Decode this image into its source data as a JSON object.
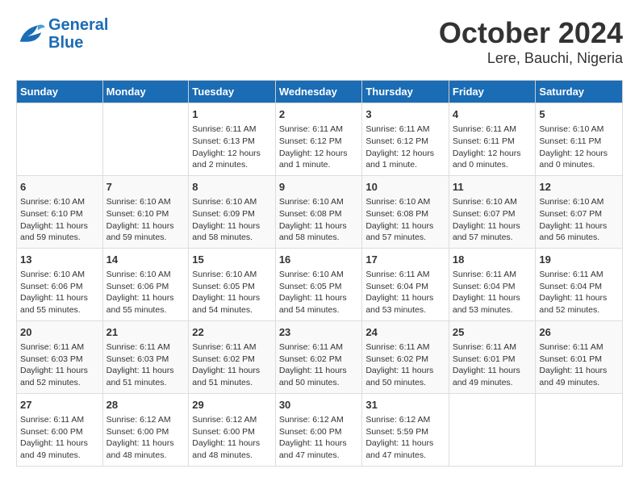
{
  "header": {
    "logo_line1": "General",
    "logo_line2": "Blue",
    "title": "October 2024",
    "subtitle": "Lere, Bauchi, Nigeria"
  },
  "weekdays": [
    "Sunday",
    "Monday",
    "Tuesday",
    "Wednesday",
    "Thursday",
    "Friday",
    "Saturday"
  ],
  "weeks": [
    [
      {
        "day": "",
        "empty": true
      },
      {
        "day": "",
        "empty": true
      },
      {
        "day": "1",
        "line1": "Sunrise: 6:11 AM",
        "line2": "Sunset: 6:13 PM",
        "line3": "Daylight: 12 hours",
        "line4": "and 2 minutes."
      },
      {
        "day": "2",
        "line1": "Sunrise: 6:11 AM",
        "line2": "Sunset: 6:12 PM",
        "line3": "Daylight: 12 hours",
        "line4": "and 1 minute."
      },
      {
        "day": "3",
        "line1": "Sunrise: 6:11 AM",
        "line2": "Sunset: 6:12 PM",
        "line3": "Daylight: 12 hours",
        "line4": "and 1 minute."
      },
      {
        "day": "4",
        "line1": "Sunrise: 6:11 AM",
        "line2": "Sunset: 6:11 PM",
        "line3": "Daylight: 12 hours",
        "line4": "and 0 minutes."
      },
      {
        "day": "5",
        "line1": "Sunrise: 6:10 AM",
        "line2": "Sunset: 6:11 PM",
        "line3": "Daylight: 12 hours",
        "line4": "and 0 minutes."
      }
    ],
    [
      {
        "day": "6",
        "line1": "Sunrise: 6:10 AM",
        "line2": "Sunset: 6:10 PM",
        "line3": "Daylight: 11 hours",
        "line4": "and 59 minutes."
      },
      {
        "day": "7",
        "line1": "Sunrise: 6:10 AM",
        "line2": "Sunset: 6:10 PM",
        "line3": "Daylight: 11 hours",
        "line4": "and 59 minutes."
      },
      {
        "day": "8",
        "line1": "Sunrise: 6:10 AM",
        "line2": "Sunset: 6:09 PM",
        "line3": "Daylight: 11 hours",
        "line4": "and 58 minutes."
      },
      {
        "day": "9",
        "line1": "Sunrise: 6:10 AM",
        "line2": "Sunset: 6:08 PM",
        "line3": "Daylight: 11 hours",
        "line4": "and 58 minutes."
      },
      {
        "day": "10",
        "line1": "Sunrise: 6:10 AM",
        "line2": "Sunset: 6:08 PM",
        "line3": "Daylight: 11 hours",
        "line4": "and 57 minutes."
      },
      {
        "day": "11",
        "line1": "Sunrise: 6:10 AM",
        "line2": "Sunset: 6:07 PM",
        "line3": "Daylight: 11 hours",
        "line4": "and 57 minutes."
      },
      {
        "day": "12",
        "line1": "Sunrise: 6:10 AM",
        "line2": "Sunset: 6:07 PM",
        "line3": "Daylight: 11 hours",
        "line4": "and 56 minutes."
      }
    ],
    [
      {
        "day": "13",
        "line1": "Sunrise: 6:10 AM",
        "line2": "Sunset: 6:06 PM",
        "line3": "Daylight: 11 hours",
        "line4": "and 55 minutes."
      },
      {
        "day": "14",
        "line1": "Sunrise: 6:10 AM",
        "line2": "Sunset: 6:06 PM",
        "line3": "Daylight: 11 hours",
        "line4": "and 55 minutes."
      },
      {
        "day": "15",
        "line1": "Sunrise: 6:10 AM",
        "line2": "Sunset: 6:05 PM",
        "line3": "Daylight: 11 hours",
        "line4": "and 54 minutes."
      },
      {
        "day": "16",
        "line1": "Sunrise: 6:10 AM",
        "line2": "Sunset: 6:05 PM",
        "line3": "Daylight: 11 hours",
        "line4": "and 54 minutes."
      },
      {
        "day": "17",
        "line1": "Sunrise: 6:11 AM",
        "line2": "Sunset: 6:04 PM",
        "line3": "Daylight: 11 hours",
        "line4": "and 53 minutes."
      },
      {
        "day": "18",
        "line1": "Sunrise: 6:11 AM",
        "line2": "Sunset: 6:04 PM",
        "line3": "Daylight: 11 hours",
        "line4": "and 53 minutes."
      },
      {
        "day": "19",
        "line1": "Sunrise: 6:11 AM",
        "line2": "Sunset: 6:04 PM",
        "line3": "Daylight: 11 hours",
        "line4": "and 52 minutes."
      }
    ],
    [
      {
        "day": "20",
        "line1": "Sunrise: 6:11 AM",
        "line2": "Sunset: 6:03 PM",
        "line3": "Daylight: 11 hours",
        "line4": "and 52 minutes."
      },
      {
        "day": "21",
        "line1": "Sunrise: 6:11 AM",
        "line2": "Sunset: 6:03 PM",
        "line3": "Daylight: 11 hours",
        "line4": "and 51 minutes."
      },
      {
        "day": "22",
        "line1": "Sunrise: 6:11 AM",
        "line2": "Sunset: 6:02 PM",
        "line3": "Daylight: 11 hours",
        "line4": "and 51 minutes."
      },
      {
        "day": "23",
        "line1": "Sunrise: 6:11 AM",
        "line2": "Sunset: 6:02 PM",
        "line3": "Daylight: 11 hours",
        "line4": "and 50 minutes."
      },
      {
        "day": "24",
        "line1": "Sunrise: 6:11 AM",
        "line2": "Sunset: 6:02 PM",
        "line3": "Daylight: 11 hours",
        "line4": "and 50 minutes."
      },
      {
        "day": "25",
        "line1": "Sunrise: 6:11 AM",
        "line2": "Sunset: 6:01 PM",
        "line3": "Daylight: 11 hours",
        "line4": "and 49 minutes."
      },
      {
        "day": "26",
        "line1": "Sunrise: 6:11 AM",
        "line2": "Sunset: 6:01 PM",
        "line3": "Daylight: 11 hours",
        "line4": "and 49 minutes."
      }
    ],
    [
      {
        "day": "27",
        "line1": "Sunrise: 6:11 AM",
        "line2": "Sunset: 6:00 PM",
        "line3": "Daylight: 11 hours",
        "line4": "and 49 minutes."
      },
      {
        "day": "28",
        "line1": "Sunrise: 6:12 AM",
        "line2": "Sunset: 6:00 PM",
        "line3": "Daylight: 11 hours",
        "line4": "and 48 minutes."
      },
      {
        "day": "29",
        "line1": "Sunrise: 6:12 AM",
        "line2": "Sunset: 6:00 PM",
        "line3": "Daylight: 11 hours",
        "line4": "and 48 minutes."
      },
      {
        "day": "30",
        "line1": "Sunrise: 6:12 AM",
        "line2": "Sunset: 6:00 PM",
        "line3": "Daylight: 11 hours",
        "line4": "and 47 minutes."
      },
      {
        "day": "31",
        "line1": "Sunrise: 6:12 AM",
        "line2": "Sunset: 5:59 PM",
        "line3": "Daylight: 11 hours",
        "line4": "and 47 minutes."
      },
      {
        "day": "",
        "empty": true
      },
      {
        "day": "",
        "empty": true
      }
    ]
  ]
}
